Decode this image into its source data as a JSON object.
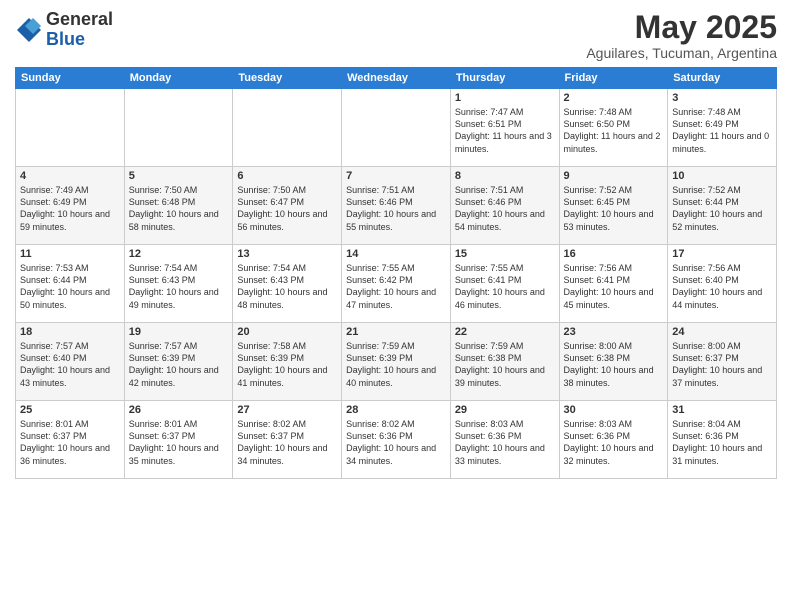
{
  "header": {
    "logo_line1": "General",
    "logo_line2": "Blue",
    "title": "May 2025",
    "subtitle": "Aguilares, Tucuman, Argentina"
  },
  "weekdays": [
    "Sunday",
    "Monday",
    "Tuesday",
    "Wednesday",
    "Thursday",
    "Friday",
    "Saturday"
  ],
  "weeks": [
    [
      {
        "day": "",
        "sunrise": "",
        "sunset": "",
        "daylight": ""
      },
      {
        "day": "",
        "sunrise": "",
        "sunset": "",
        "daylight": ""
      },
      {
        "day": "",
        "sunrise": "",
        "sunset": "",
        "daylight": ""
      },
      {
        "day": "",
        "sunrise": "",
        "sunset": "",
        "daylight": ""
      },
      {
        "day": "1",
        "sunrise": "Sunrise: 7:47 AM",
        "sunset": "Sunset: 6:51 PM",
        "daylight": "Daylight: 11 hours and 3 minutes."
      },
      {
        "day": "2",
        "sunrise": "Sunrise: 7:48 AM",
        "sunset": "Sunset: 6:50 PM",
        "daylight": "Daylight: 11 hours and 2 minutes."
      },
      {
        "day": "3",
        "sunrise": "Sunrise: 7:48 AM",
        "sunset": "Sunset: 6:49 PM",
        "daylight": "Daylight: 11 hours and 0 minutes."
      }
    ],
    [
      {
        "day": "4",
        "sunrise": "Sunrise: 7:49 AM",
        "sunset": "Sunset: 6:49 PM",
        "daylight": "Daylight: 10 hours and 59 minutes."
      },
      {
        "day": "5",
        "sunrise": "Sunrise: 7:50 AM",
        "sunset": "Sunset: 6:48 PM",
        "daylight": "Daylight: 10 hours and 58 minutes."
      },
      {
        "day": "6",
        "sunrise": "Sunrise: 7:50 AM",
        "sunset": "Sunset: 6:47 PM",
        "daylight": "Daylight: 10 hours and 56 minutes."
      },
      {
        "day": "7",
        "sunrise": "Sunrise: 7:51 AM",
        "sunset": "Sunset: 6:46 PM",
        "daylight": "Daylight: 10 hours and 55 minutes."
      },
      {
        "day": "8",
        "sunrise": "Sunrise: 7:51 AM",
        "sunset": "Sunset: 6:46 PM",
        "daylight": "Daylight: 10 hours and 54 minutes."
      },
      {
        "day": "9",
        "sunrise": "Sunrise: 7:52 AM",
        "sunset": "Sunset: 6:45 PM",
        "daylight": "Daylight: 10 hours and 53 minutes."
      },
      {
        "day": "10",
        "sunrise": "Sunrise: 7:52 AM",
        "sunset": "Sunset: 6:44 PM",
        "daylight": "Daylight: 10 hours and 52 minutes."
      }
    ],
    [
      {
        "day": "11",
        "sunrise": "Sunrise: 7:53 AM",
        "sunset": "Sunset: 6:44 PM",
        "daylight": "Daylight: 10 hours and 50 minutes."
      },
      {
        "day": "12",
        "sunrise": "Sunrise: 7:54 AM",
        "sunset": "Sunset: 6:43 PM",
        "daylight": "Daylight: 10 hours and 49 minutes."
      },
      {
        "day": "13",
        "sunrise": "Sunrise: 7:54 AM",
        "sunset": "Sunset: 6:43 PM",
        "daylight": "Daylight: 10 hours and 48 minutes."
      },
      {
        "day": "14",
        "sunrise": "Sunrise: 7:55 AM",
        "sunset": "Sunset: 6:42 PM",
        "daylight": "Daylight: 10 hours and 47 minutes."
      },
      {
        "day": "15",
        "sunrise": "Sunrise: 7:55 AM",
        "sunset": "Sunset: 6:41 PM",
        "daylight": "Daylight: 10 hours and 46 minutes."
      },
      {
        "day": "16",
        "sunrise": "Sunrise: 7:56 AM",
        "sunset": "Sunset: 6:41 PM",
        "daylight": "Daylight: 10 hours and 45 minutes."
      },
      {
        "day": "17",
        "sunrise": "Sunrise: 7:56 AM",
        "sunset": "Sunset: 6:40 PM",
        "daylight": "Daylight: 10 hours and 44 minutes."
      }
    ],
    [
      {
        "day": "18",
        "sunrise": "Sunrise: 7:57 AM",
        "sunset": "Sunset: 6:40 PM",
        "daylight": "Daylight: 10 hours and 43 minutes."
      },
      {
        "day": "19",
        "sunrise": "Sunrise: 7:57 AM",
        "sunset": "Sunset: 6:39 PM",
        "daylight": "Daylight: 10 hours and 42 minutes."
      },
      {
        "day": "20",
        "sunrise": "Sunrise: 7:58 AM",
        "sunset": "Sunset: 6:39 PM",
        "daylight": "Daylight: 10 hours and 41 minutes."
      },
      {
        "day": "21",
        "sunrise": "Sunrise: 7:59 AM",
        "sunset": "Sunset: 6:39 PM",
        "daylight": "Daylight: 10 hours and 40 minutes."
      },
      {
        "day": "22",
        "sunrise": "Sunrise: 7:59 AM",
        "sunset": "Sunset: 6:38 PM",
        "daylight": "Daylight: 10 hours and 39 minutes."
      },
      {
        "day": "23",
        "sunrise": "Sunrise: 8:00 AM",
        "sunset": "Sunset: 6:38 PM",
        "daylight": "Daylight: 10 hours and 38 minutes."
      },
      {
        "day": "24",
        "sunrise": "Sunrise: 8:00 AM",
        "sunset": "Sunset: 6:37 PM",
        "daylight": "Daylight: 10 hours and 37 minutes."
      }
    ],
    [
      {
        "day": "25",
        "sunrise": "Sunrise: 8:01 AM",
        "sunset": "Sunset: 6:37 PM",
        "daylight": "Daylight: 10 hours and 36 minutes."
      },
      {
        "day": "26",
        "sunrise": "Sunrise: 8:01 AM",
        "sunset": "Sunset: 6:37 PM",
        "daylight": "Daylight: 10 hours and 35 minutes."
      },
      {
        "day": "27",
        "sunrise": "Sunrise: 8:02 AM",
        "sunset": "Sunset: 6:37 PM",
        "daylight": "Daylight: 10 hours and 34 minutes."
      },
      {
        "day": "28",
        "sunrise": "Sunrise: 8:02 AM",
        "sunset": "Sunset: 6:36 PM",
        "daylight": "Daylight: 10 hours and 34 minutes."
      },
      {
        "day": "29",
        "sunrise": "Sunrise: 8:03 AM",
        "sunset": "Sunset: 6:36 PM",
        "daylight": "Daylight: 10 hours and 33 minutes."
      },
      {
        "day": "30",
        "sunrise": "Sunrise: 8:03 AM",
        "sunset": "Sunset: 6:36 PM",
        "daylight": "Daylight: 10 hours and 32 minutes."
      },
      {
        "day": "31",
        "sunrise": "Sunrise: 8:04 AM",
        "sunset": "Sunset: 6:36 PM",
        "daylight": "Daylight: 10 hours and 31 minutes."
      }
    ]
  ]
}
